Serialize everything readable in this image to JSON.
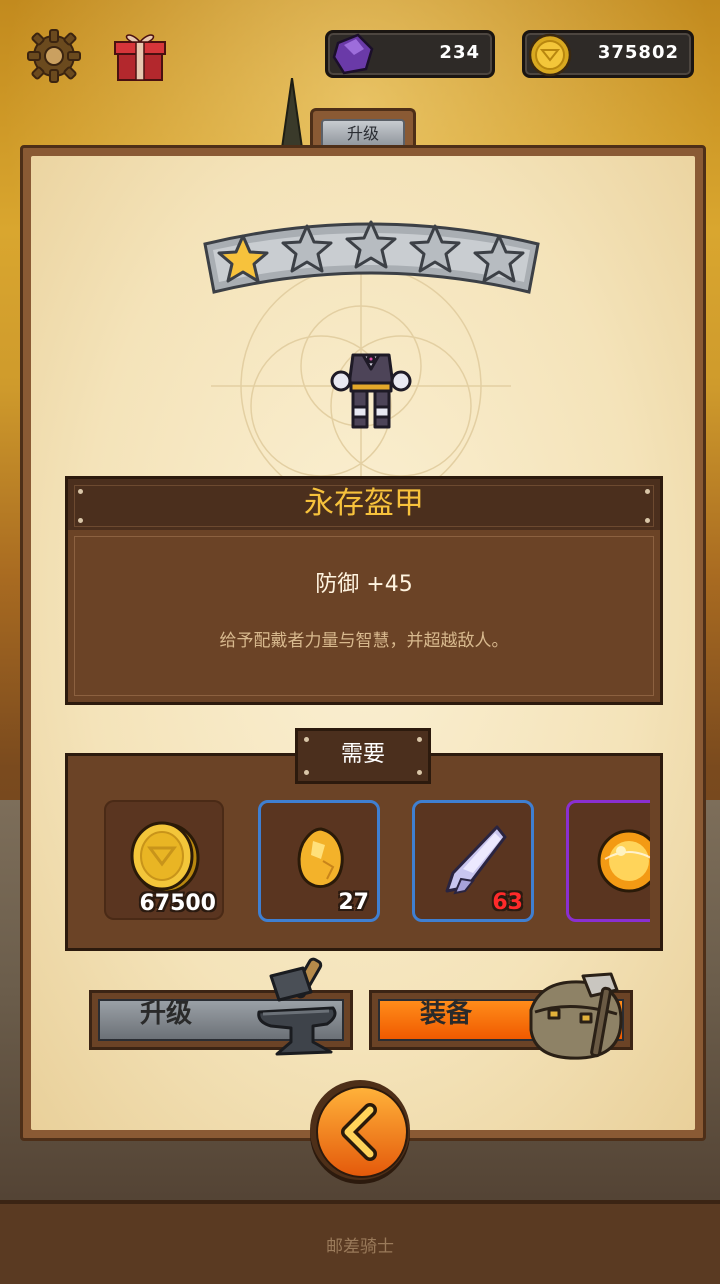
{
  "currency": {
    "gems": "234",
    "coins": "375802"
  },
  "tab": {
    "label": "升级"
  },
  "item": {
    "stars_filled": 1,
    "stars_total": 5,
    "name": "永存盔甲",
    "stat": "防御 +45",
    "description": "给予配戴者力量与智慧，并超越敌人。"
  },
  "requirements": {
    "title": "需要",
    "items": [
      {
        "icon": "gold-coin-icon",
        "count": "67500"
      },
      {
        "icon": "amber-ore-icon",
        "count": "27"
      },
      {
        "icon": "crystal-shard-icon",
        "count": "63"
      },
      {
        "icon": "fire-orb-icon",
        "count": ""
      }
    ]
  },
  "buttons": {
    "upgrade": "升级",
    "equip": "装备"
  },
  "footer": "邮差骑士",
  "colors": {
    "star_gold": "#f7c23c",
    "equip_orange": "#f05a00",
    "rare_blue": "#3f7fd1",
    "epic_purple": "#8a2fd0",
    "insufficient_red": "#ff2a2a"
  }
}
